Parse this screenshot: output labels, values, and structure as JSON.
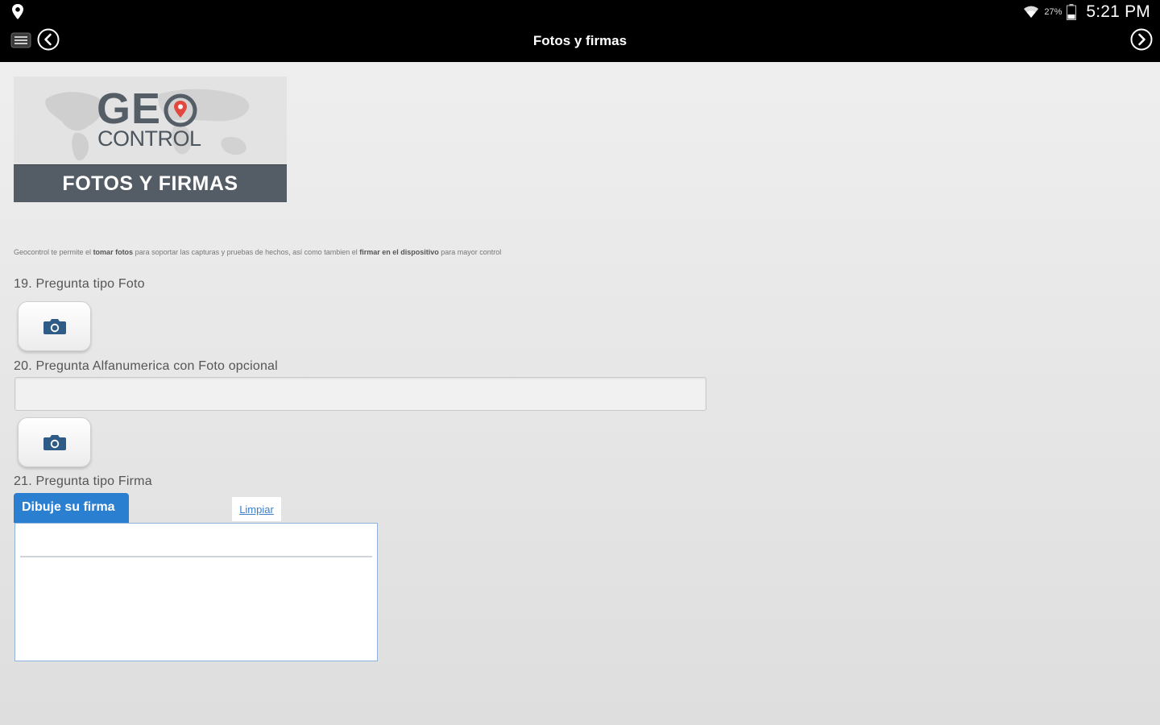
{
  "status_bar": {
    "battery_percent": "27%",
    "time": "5:21 PM",
    "icons": [
      "location-pin-icon",
      "wifi-icon",
      "battery-icon"
    ]
  },
  "nav": {
    "title": "Fotos y firmas",
    "icons": [
      "menu-icon",
      "back-icon",
      "forward-icon"
    ]
  },
  "banner": {
    "logo_line1": "GE",
    "logo_line2": "CONTROL",
    "caption": "FOTOS Y FIRMAS"
  },
  "intro": {
    "part1": "Geocontrol te permite el ",
    "bold1": "tomar fotos",
    "part2": " para soportar las capturas y pruebas de hechos, así como tambien el ",
    "bold2": "firmar en el dispositivo",
    "part3": " para mayor control"
  },
  "questions": {
    "q19_label": "19. Pregunta tipo Foto",
    "q20_label": "20. Pregunta Alfanumerica con Foto opcional",
    "q20_value": "",
    "q21_label": "21. Pregunta tipo Firma"
  },
  "signature": {
    "tab_label": "Dibuje su firma",
    "clear_label": "Limpiar"
  },
  "colors": {
    "topbar": "#000000",
    "banner_strip": "#545c66",
    "signature_tab": "#2a7fd1",
    "camera_icon": "#2f5c86"
  }
}
